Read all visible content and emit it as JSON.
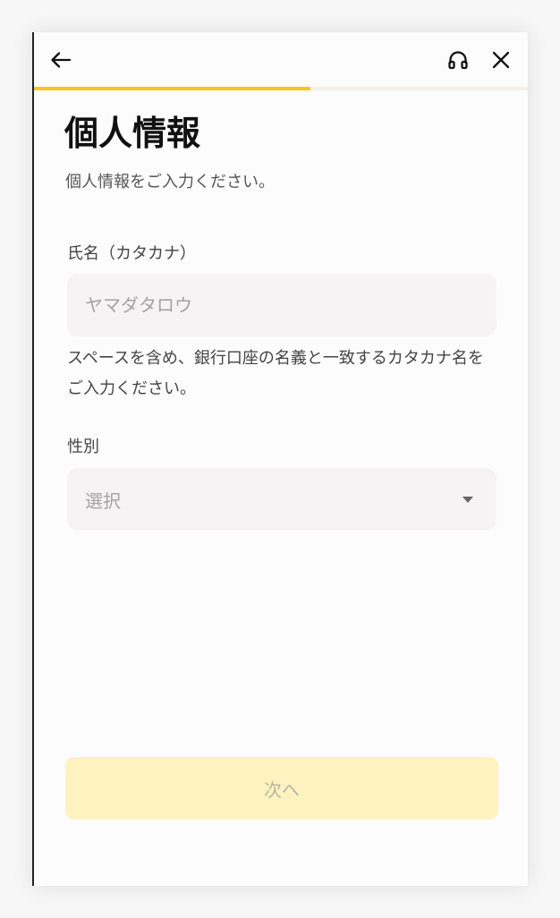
{
  "progress": {
    "fraction": 0.56,
    "color": "#f5c623"
  },
  "header": {
    "back_icon": "arrow-left-icon",
    "support_icon": "headset-icon",
    "close_icon": "close-icon"
  },
  "page": {
    "title": "個人情報",
    "subtitle": "個人情報をご入力ください。"
  },
  "form": {
    "name": {
      "label": "氏名（カタカナ）",
      "placeholder": "ヤマダタロウ",
      "value": "",
      "helper": "スペースを含め、銀行口座の名義と一致するカタカナ名をご入力ください。"
    },
    "gender": {
      "label": "性別",
      "selected": "選択",
      "caret_icon": "caret-down-icon"
    }
  },
  "footer": {
    "next_label": "次へ",
    "button_color": "#fef3c0"
  }
}
